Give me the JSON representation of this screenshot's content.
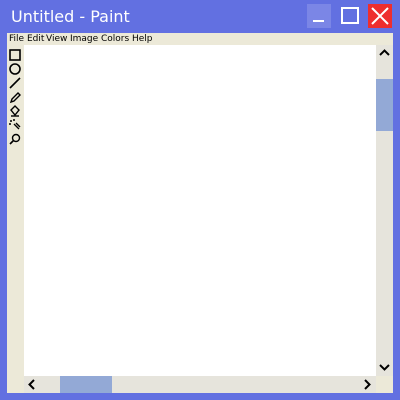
{
  "window": {
    "title": "Untitled - Paint"
  },
  "menubar": {
    "items": [
      "File",
      "Edit",
      "View",
      "Image",
      "Colors",
      "Help"
    ]
  },
  "toolbox": {
    "tools": [
      "rectangle-select-icon",
      "ellipse-icon",
      "line-icon",
      "pencil-icon",
      "fill-bucket-icon",
      "airbrush-icon",
      "magnifier-icon"
    ]
  },
  "colors": {
    "titlebar": "#6270e1",
    "close": "#ee2e2e",
    "chrome": "#ece9d8",
    "scrollbar_thumb": "#93a9d6"
  }
}
